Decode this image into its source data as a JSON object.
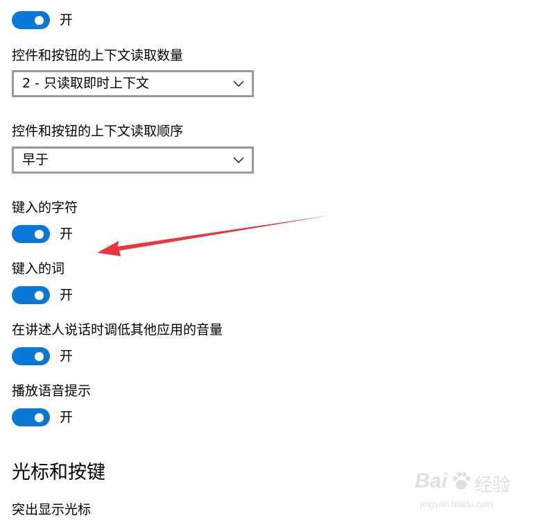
{
  "top_toggle": {
    "state_label": "开",
    "on": true
  },
  "reading_amount": {
    "label": "控件和按钮的上下文读取数量",
    "selected": "2 - 只读取即时上下文"
  },
  "reading_order": {
    "label": "控件和按钮的上下文读取顺序",
    "selected": "早于"
  },
  "typed_characters": {
    "label": "键入的字符",
    "state_label": "开",
    "on": true
  },
  "typed_words": {
    "label": "键入的词",
    "state_label": "开",
    "on": true
  },
  "lower_volume": {
    "label": "在讲述人说话时调低其他应用的音量",
    "state_label": "开",
    "on": true
  },
  "audio_cues": {
    "label": "播放语音提示",
    "state_label": "开",
    "on": true
  },
  "cursor_section": {
    "title": "光标和按键",
    "highlight_cursor_label": "突出显示光标"
  },
  "watermark": {
    "brand": "Bai",
    "brand_suffix": "经验",
    "url": "jingyan.baidu.com"
  },
  "colors": {
    "toggle_on": "#0a78d7",
    "annotation_arrow": "#e8383d"
  }
}
